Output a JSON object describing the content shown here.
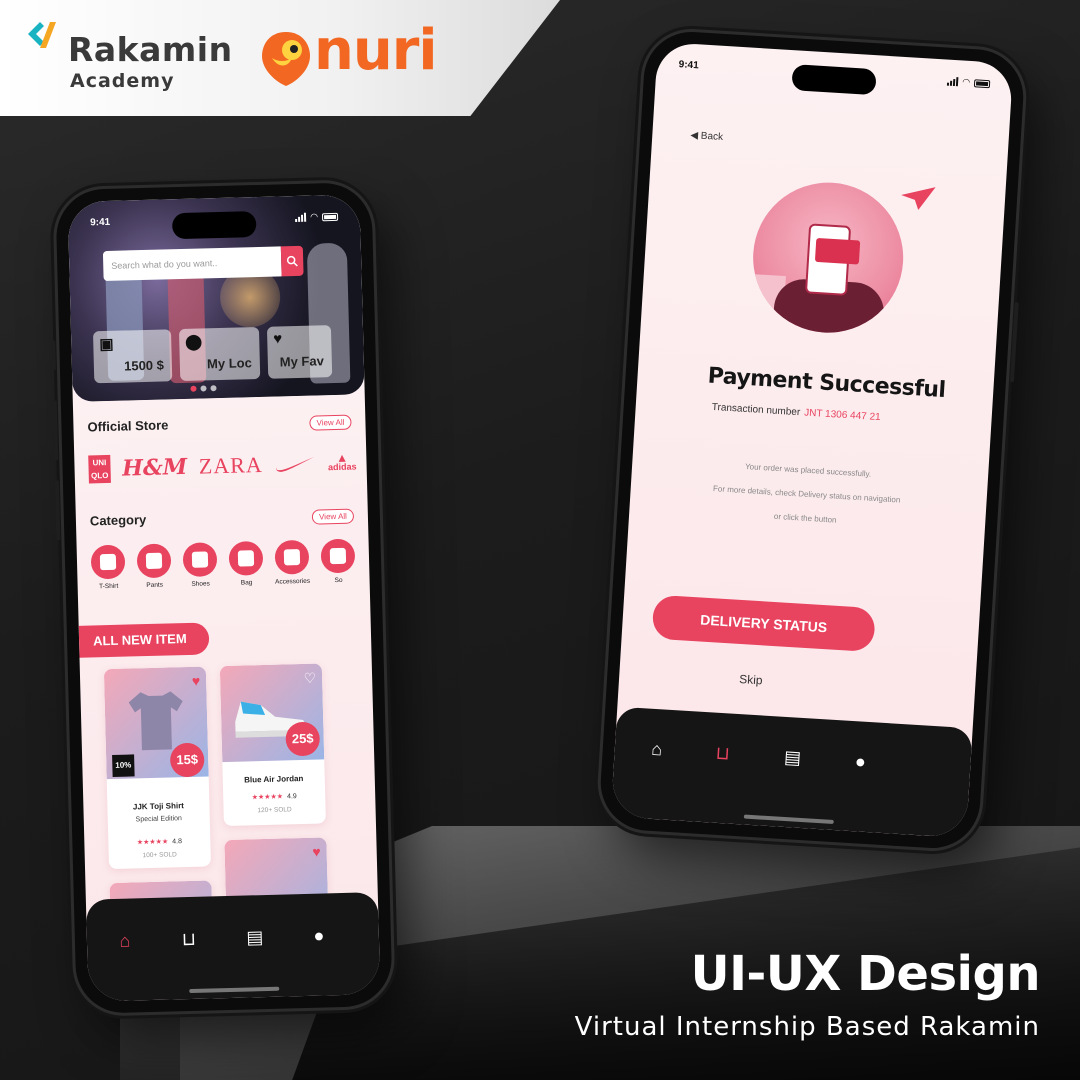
{
  "branding": {
    "rakamin_name": "Rakamin",
    "rakamin_sub": "Academy",
    "nuri_name": "nuri"
  },
  "caption": {
    "title": "UI-UX Design",
    "subtitle": "Virtual Internship Based Rakamin"
  },
  "left_phone": {
    "status_time": "9:41",
    "search_placeholder": "Search what do you want..",
    "hero_cards": [
      {
        "label": "1500 $",
        "icon": "money-icon"
      },
      {
        "label": "My Loc",
        "icon": "location-pin-icon"
      },
      {
        "label": "My Fav",
        "icon": "heart-icon"
      }
    ],
    "official_store": {
      "title": "Official Store",
      "view_all": "View All"
    },
    "brands": {
      "uniqlo_1": "UNI",
      "uniqlo_2": "QLO",
      "hm": "H&M",
      "zara": "ZARA",
      "adidas": "adidas"
    },
    "category": {
      "title": "Category",
      "view_all": "View All",
      "items": [
        "T-Shirt",
        "Pants",
        "Shoes",
        "Bag",
        "Accessories",
        "So"
      ]
    },
    "new_item_label": "ALL NEW ITEM",
    "products": [
      {
        "name": "JJK Toji Shirt",
        "subtitle": "Special Edition",
        "rating": "4.8",
        "sold": "100+ SOLD",
        "price": "15$",
        "badge": "10%"
      },
      {
        "name": "Blue Air Jordan",
        "rating": "4.9",
        "sold": "120+ SOLD",
        "price": "25$"
      }
    ],
    "stars": "★★★★★"
  },
  "right_phone": {
    "status_time": "9:41",
    "back_label": "Back",
    "title": "Payment Successful",
    "transaction_label": "Transaction number",
    "transaction_number": "JNT 1306 447 21",
    "message_lines": [
      "Your order was placed successfully.",
      "For more details, check Delivery status on navigation",
      "or click the button"
    ],
    "primary_button": "DELIVERY STATUS",
    "skip_label": "Skip"
  },
  "nav_icons": [
    "home-icon",
    "basket-icon",
    "delivery-truck-icon",
    "profile-icon"
  ],
  "colors": {
    "accent": "#e8435f",
    "nuri_orange": "#f26722",
    "navbar": "#151515",
    "background": "#1c1c1c"
  }
}
